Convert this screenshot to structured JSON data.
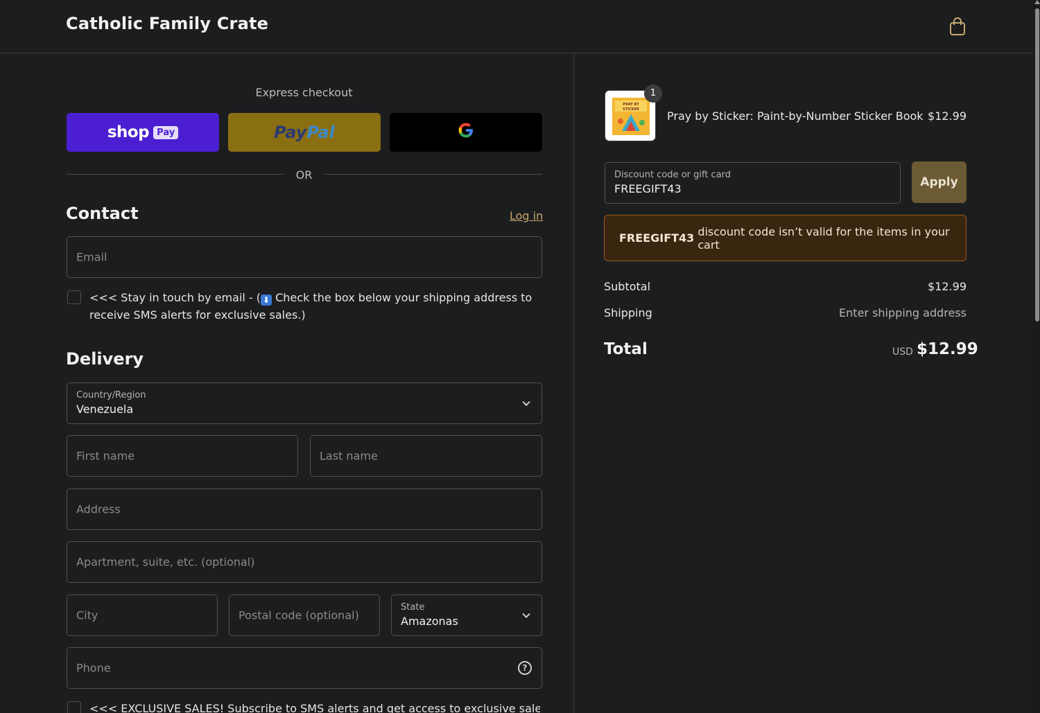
{
  "header": {
    "brand": "Catholic Family Crate",
    "cart_icon": "shopping-bag-icon"
  },
  "express": {
    "label": "Express checkout",
    "shop_pay": {
      "word": "shop",
      "badge": "Pay",
      "color": "#4b1fd1"
    },
    "paypal": {
      "part1": "Pay",
      "part2": "Pal",
      "color": "#8a6f12"
    },
    "gpay": {
      "letter": "G",
      "color": "#000000"
    },
    "or": "OR"
  },
  "contact": {
    "title": "Contact",
    "login": "Log in",
    "email_placeholder": "Email",
    "newsletter_text_1": "<<< Stay in touch by email - (",
    "newsletter_emoji": "⬇",
    "newsletter_text_2": "Check the box below your shipping address to",
    "newsletter_text_3": "receive SMS alerts for exclusive sales.)"
  },
  "delivery": {
    "title": "Delivery",
    "country_label": "Country/Region",
    "country_value": "Venezuela",
    "first_name": "First name",
    "last_name": "Last name",
    "address": "Address",
    "apartment": "Apartment, suite, etc. (optional)",
    "city": "City",
    "postal": "Postal code (optional)",
    "state_label": "State",
    "state_value": "Amazonas",
    "phone": "Phone",
    "sms_text": "<<< EXCLUSIVE SALES! Subscribe to SMS alerts and get access to exclusive sales and"
  },
  "order": {
    "quantity": "1",
    "product_name": "Pray by Sticker: Paint-by-Number Sticker Book",
    "product_price": "$12.99",
    "thumb_text": "PRAY BY STICKER",
    "discount_label": "Discount code or gift card",
    "discount_value": "FREEGIFT43",
    "apply": "Apply",
    "error_code": "FREEGIFT43",
    "error_text": "discount code isn’t valid for the items in your cart",
    "subtotal_label": "Subtotal",
    "subtotal_value": "$12.99",
    "shipping_label": "Shipping",
    "shipping_value": "Enter shipping address",
    "total_label": "Total",
    "total_currency": "USD",
    "total_value": "$12.99"
  },
  "colors": {
    "background": "#1c1d1f",
    "accent": "#c9a96e",
    "apply": "#6b5a33",
    "error_bg": "#3a250f"
  }
}
